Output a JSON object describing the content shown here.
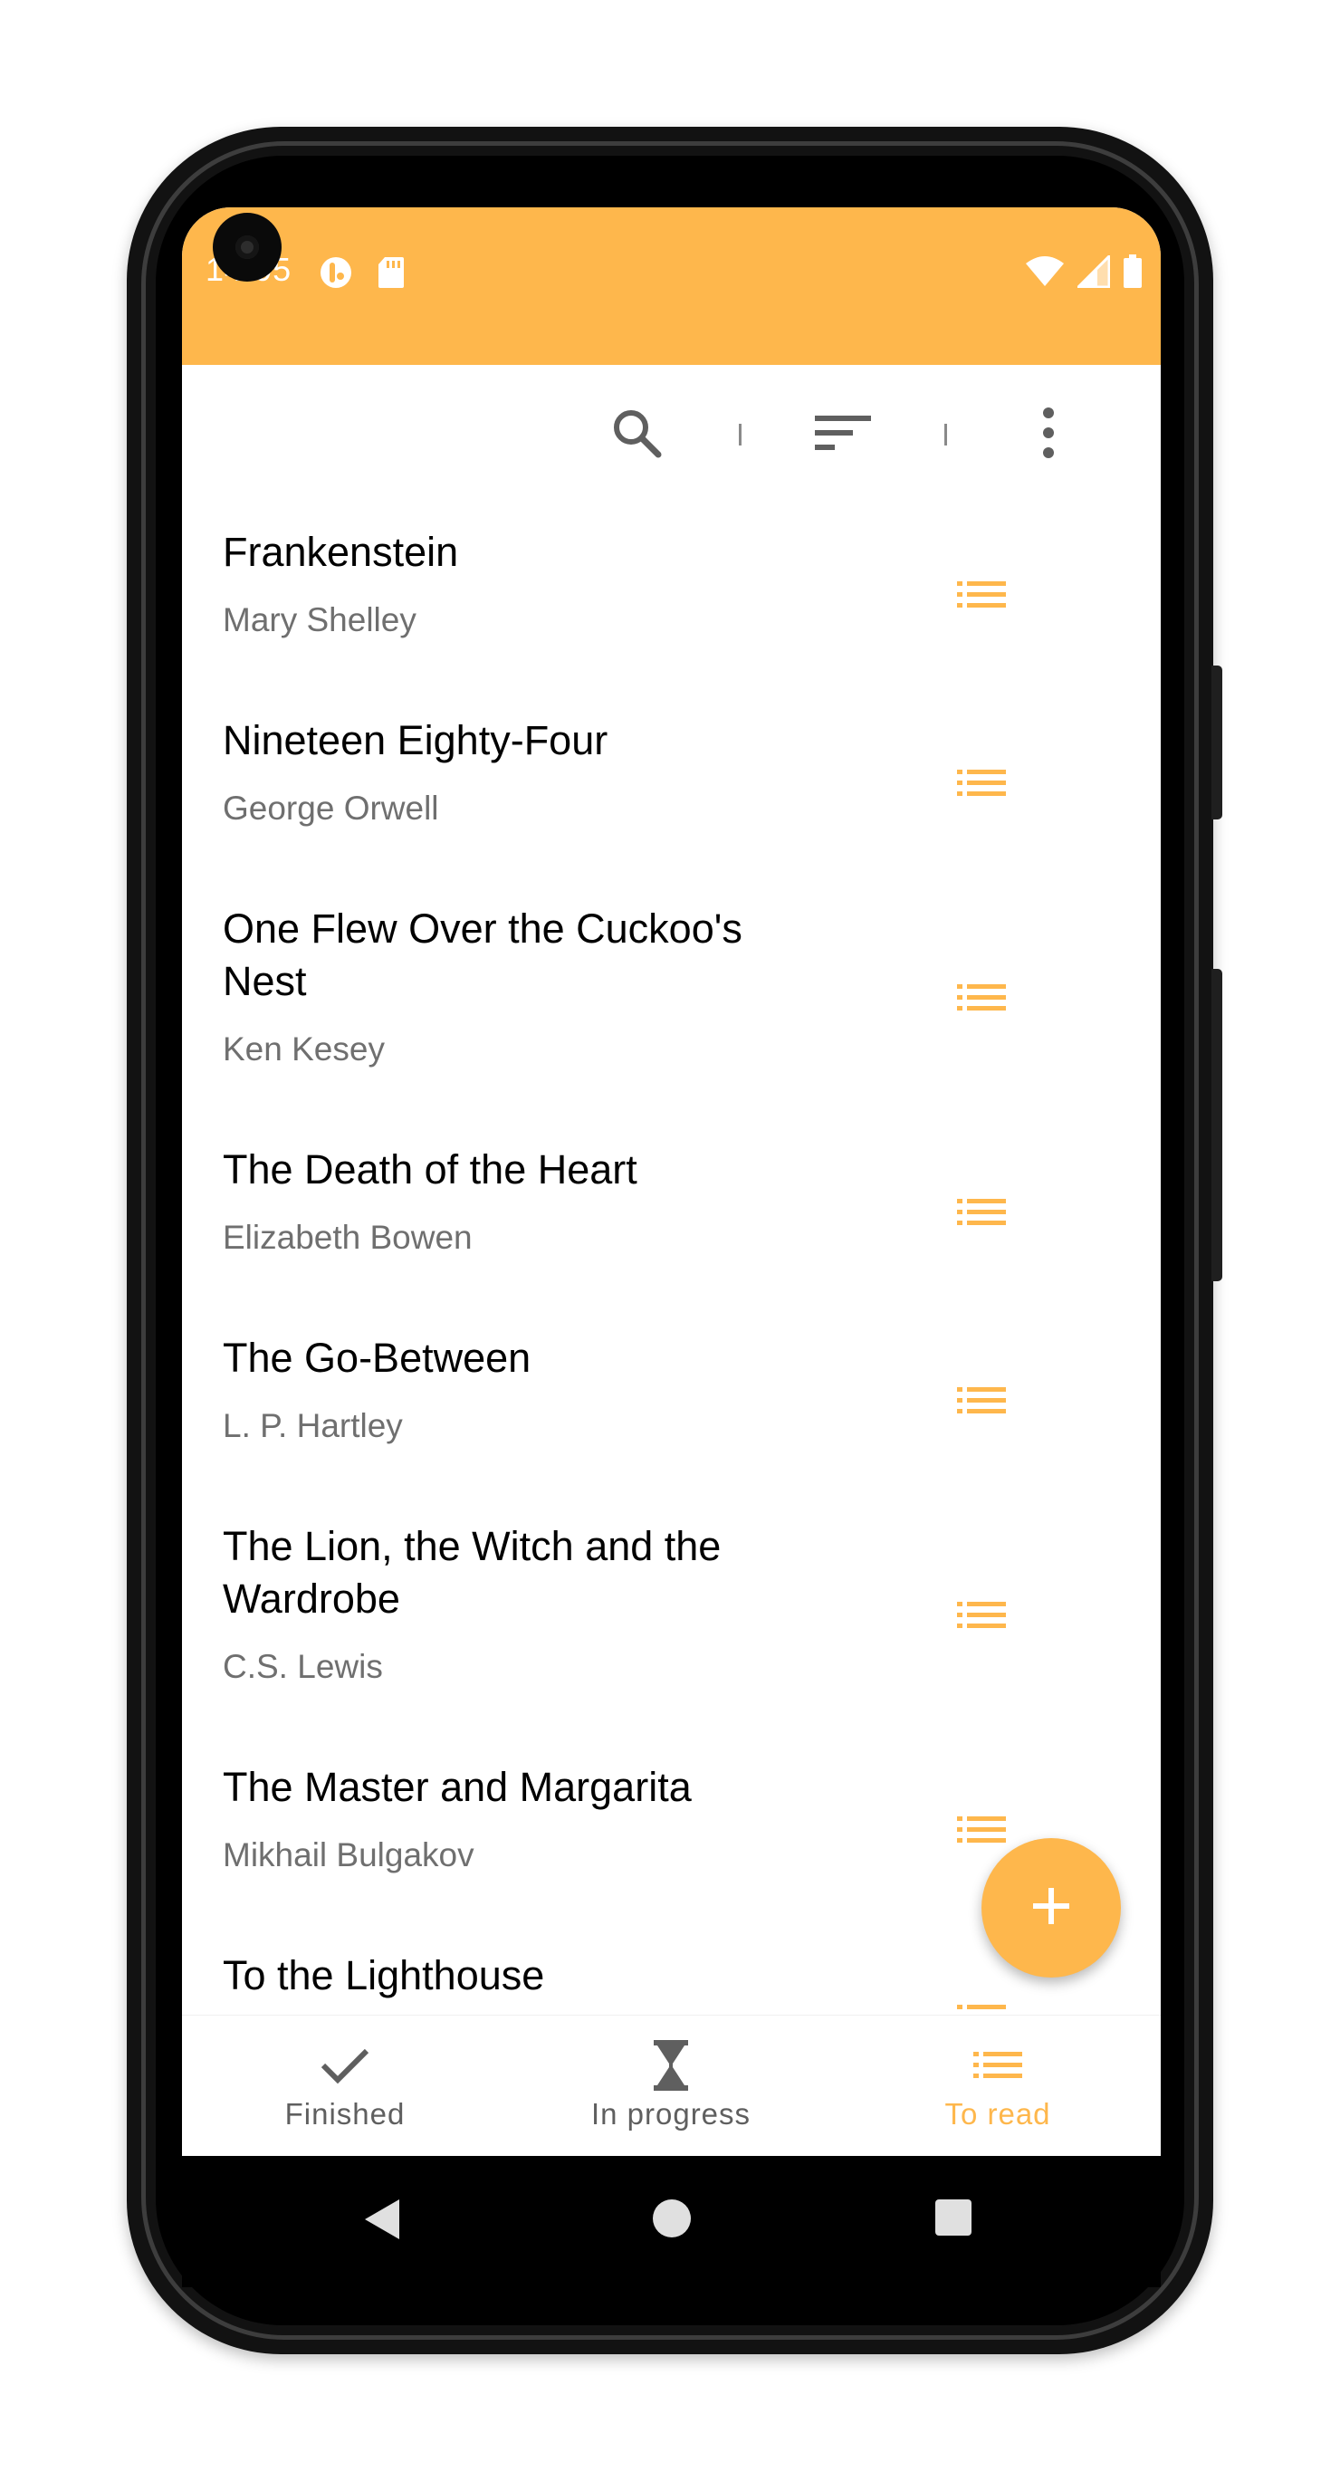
{
  "status_bar": {
    "time": "14:05",
    "icons_left": [
      "assistant-icon",
      "sd-card-icon"
    ],
    "icons_right": [
      "wifi-icon",
      "signal-icon",
      "battery-icon"
    ],
    "background": "#FEB74C"
  },
  "toolbar": {
    "icons": [
      "search-icon",
      "sort-icon",
      "more-vert-icon"
    ]
  },
  "books": [
    {
      "title": "Frankenstein",
      "author": "Mary Shelley"
    },
    {
      "title": "Nineteen Eighty-Four",
      "author": "George Orwell"
    },
    {
      "title": "One Flew Over the Cuckoo's Nest",
      "author": "Ken Kesey"
    },
    {
      "title": "The Death of the Heart",
      "author": "Elizabeth Bowen"
    },
    {
      "title": "The Go-Between",
      "author": "L. P. Hartley"
    },
    {
      "title": "The Lion, the Witch and the Wardrobe",
      "author": "C.S. Lewis"
    },
    {
      "title": "The Master and Margarita",
      "author": "Mikhail Bulgakov"
    },
    {
      "title": "To the Lighthouse",
      "author": ""
    }
  ],
  "fab": {
    "icon": "plus-icon"
  },
  "bottom_nav": {
    "items": [
      {
        "label": "Finished",
        "icon": "check-icon",
        "active": false
      },
      {
        "label": "In progress",
        "icon": "hourglass-icon",
        "active": false
      },
      {
        "label": "To read",
        "icon": "list-icon",
        "active": true
      }
    ]
  },
  "system_nav": {
    "buttons": [
      "back-icon",
      "home-icon",
      "recents-icon"
    ]
  },
  "colors": {
    "accent": "#FEB74C",
    "text_primary": "#000000",
    "text_secondary": "#6F6F6F",
    "icon_gray": "#5F5F5F"
  }
}
